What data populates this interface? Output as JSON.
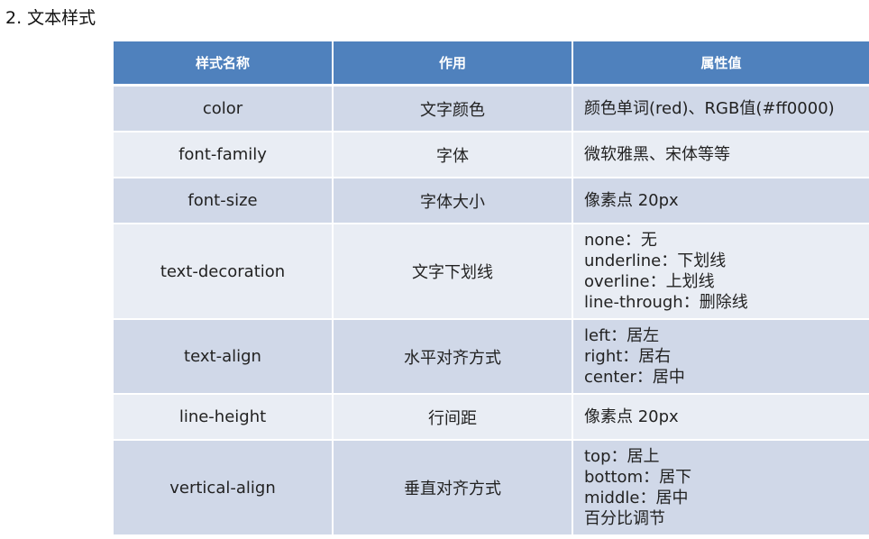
{
  "heading": "2. 文本样式",
  "table": {
    "headers": [
      "样式名称",
      "作用",
      "属性值"
    ],
    "rows": [
      {
        "name": "color",
        "effect": "文字颜色",
        "values": [
          "颜色单词(red)、RGB值(#ff0000)"
        ]
      },
      {
        "name": "font-family",
        "effect": "字体",
        "values": [
          "微软雅黑、宋体等等"
        ]
      },
      {
        "name": "font-size",
        "effect": "字体大小",
        "values": [
          "像素点  20px"
        ]
      },
      {
        "name": "text-decoration",
        "effect": "文字下划线",
        "values": [
          "none：无",
          "underline：下划线",
          "overline：上划线",
          "line-through：删除线"
        ]
      },
      {
        "name": "text-align",
        "effect": "水平对齐方式",
        "values": [
          "left：居左",
          "right：居右",
          "center：居中"
        ]
      },
      {
        "name": "line-height",
        "effect": "行间距",
        "values": [
          "像素点 20px"
        ]
      },
      {
        "name": "vertical-align",
        "effect": "垂直对齐方式",
        "values": [
          "top：居上",
          "bottom：居下",
          "middle：居中",
          "百分比调节"
        ]
      }
    ]
  },
  "colors": {
    "header_bg": "#4f81bd",
    "row_dark": "#d0d8e8",
    "row_light": "#e9edf4"
  }
}
